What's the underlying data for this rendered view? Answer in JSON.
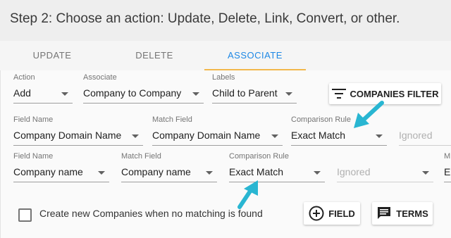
{
  "header": {
    "title": "Step 2: Choose an action: Update, Delete, Link, Convert, or other."
  },
  "tabs": [
    {
      "label": "UPDATE",
      "active": false
    },
    {
      "label": "DELETE",
      "active": false
    },
    {
      "label": "ASSOCIATE",
      "active": true
    }
  ],
  "row1": {
    "action": {
      "label": "Action",
      "value": "Add"
    },
    "associate": {
      "label": "Associate",
      "value": "Company to Company"
    },
    "labels": {
      "label": "Labels",
      "value": "Child to Parent"
    },
    "filter_button": "COMPANIES FILTER"
  },
  "row2": {
    "field_name": {
      "label": "Field Name",
      "value": "Company Domain Name"
    },
    "match_field": {
      "label": "Match Field",
      "value": "Company Domain Name"
    },
    "comparison_rule": {
      "label": "Comparison Rule",
      "value": "Exact Match"
    },
    "extra": {
      "value": "Ignored"
    }
  },
  "row3": {
    "field_name": {
      "label": "Field Name",
      "value": "Company name"
    },
    "match_field": {
      "label": "Match Field",
      "value": "Company name"
    },
    "comparison_rule": {
      "label": "Comparison Rule",
      "value": "Exact Match"
    },
    "extra": {
      "value": "Ignored"
    },
    "cut_label": "M",
    "cut_value": "Er"
  },
  "footer": {
    "checkbox_label": "Create new Companies when no matching is found",
    "checked": false,
    "field_button": "FIELD",
    "terms_button": "TERMS"
  },
  "colors": {
    "accent": "#1e88e5",
    "tab_underline": "#f2b84b",
    "annotation_arrow": "#29b6d2"
  }
}
